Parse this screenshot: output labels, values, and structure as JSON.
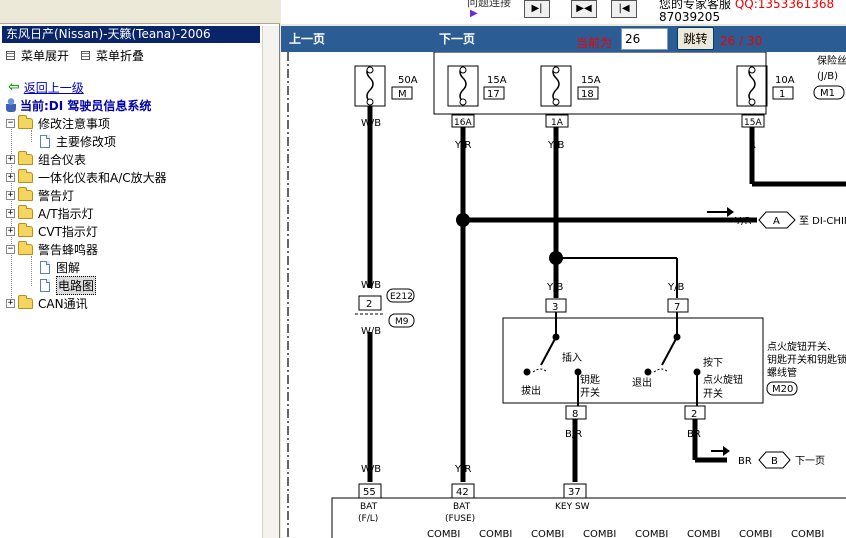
{
  "left_panel": {
    "title": "东风日产(Nissan)-天籁(Teana)-2006",
    "expand_all": "菜单展开",
    "collapse_all": "菜单折叠",
    "back": "返回上一级",
    "current": "当前:DI 驾驶员信息系统",
    "tree": [
      {
        "label": "修改注意事项",
        "type": "folder",
        "expanded": true
      },
      {
        "label": "主要修改项",
        "type": "page"
      },
      {
        "label": "组合仪表",
        "type": "folder",
        "expanded": false
      },
      {
        "label": "一体化仪表和A/C放大器",
        "type": "folder",
        "expanded": false
      },
      {
        "label": "警告灯",
        "type": "folder",
        "expanded": false
      },
      {
        "label": "A/T指示灯",
        "type": "folder",
        "expanded": false
      },
      {
        "label": "CVT指示灯",
        "type": "folder",
        "expanded": false
      },
      {
        "label": "警告蜂鸣器",
        "type": "folder",
        "expanded": true
      },
      {
        "label": "图解",
        "type": "page"
      },
      {
        "label": "电路图",
        "type": "page",
        "selected": true
      },
      {
        "label": "CAN通讯",
        "type": "folder",
        "expanded": false
      }
    ]
  },
  "topbar": {
    "ad_line1_a": "您的专家客服",
    "ad_line1_b": "QQ:1353361368",
    "ad_line2": "87039205",
    "ad_left": "问题连接",
    "ad_pointer": "▶"
  },
  "navbar": {
    "prev": "上一页",
    "next": "下一页",
    "current_label": "当前为",
    "page_value": "26",
    "jump": "跳转",
    "page_count": "26 / 30"
  },
  "diagram": {
    "fuses": [
      {
        "amp": "50A",
        "id": "M"
      },
      {
        "amp": "15A",
        "id": "17"
      },
      {
        "amp": "15A",
        "id": "18"
      },
      {
        "amp": "10A",
        "id": "1"
      }
    ],
    "fuse_box_label_a": "保险丝盒",
    "fuse_box_label_b": "(J/B)",
    "fuse_box_conn": "M1",
    "fuse_box_pins": [
      "16A",
      "1A",
      "15A"
    ],
    "wires": {
      "wb": "W/B",
      "yr": "Y/R",
      "r": "R",
      "yb": "Y/B",
      "br": "B/R",
      "brr": "BR"
    },
    "conn_e212": "E212",
    "conn_m9": "M9",
    "pin_2": "2",
    "to_a_wire": "Y/R",
    "to_a_circle": "A",
    "to_a_label": "至 DI-CHIME",
    "switch_pins": [
      "3",
      "7",
      "8",
      "2"
    ],
    "switch_insert": "插入",
    "switch_pull": "拔出",
    "switch_key_a": "钥匙",
    "switch_key_b": "开关",
    "switch_press": "按下",
    "switch_out": "退出",
    "switch_knob_a": "点火旋钮",
    "switch_knob_b": "开关",
    "switch_title_a": "点火旋钮开关、",
    "switch_title_b": "钥匙开关和钥匙锁",
    "switch_title_c": "螺线管",
    "switch_conn": "M20",
    "to_b_wire": "BR",
    "to_b_circle": "B",
    "to_b_label": "下一页",
    "bottom_pins": [
      {
        "pin": "55",
        "label": "BAT",
        "sub": "(F/L)"
      },
      {
        "pin": "42",
        "label": "BAT",
        "sub": "(FUSE)"
      },
      {
        "pin": "37",
        "label": "KEY SW",
        "sub": ""
      }
    ],
    "combi_label": "COMBI"
  }
}
